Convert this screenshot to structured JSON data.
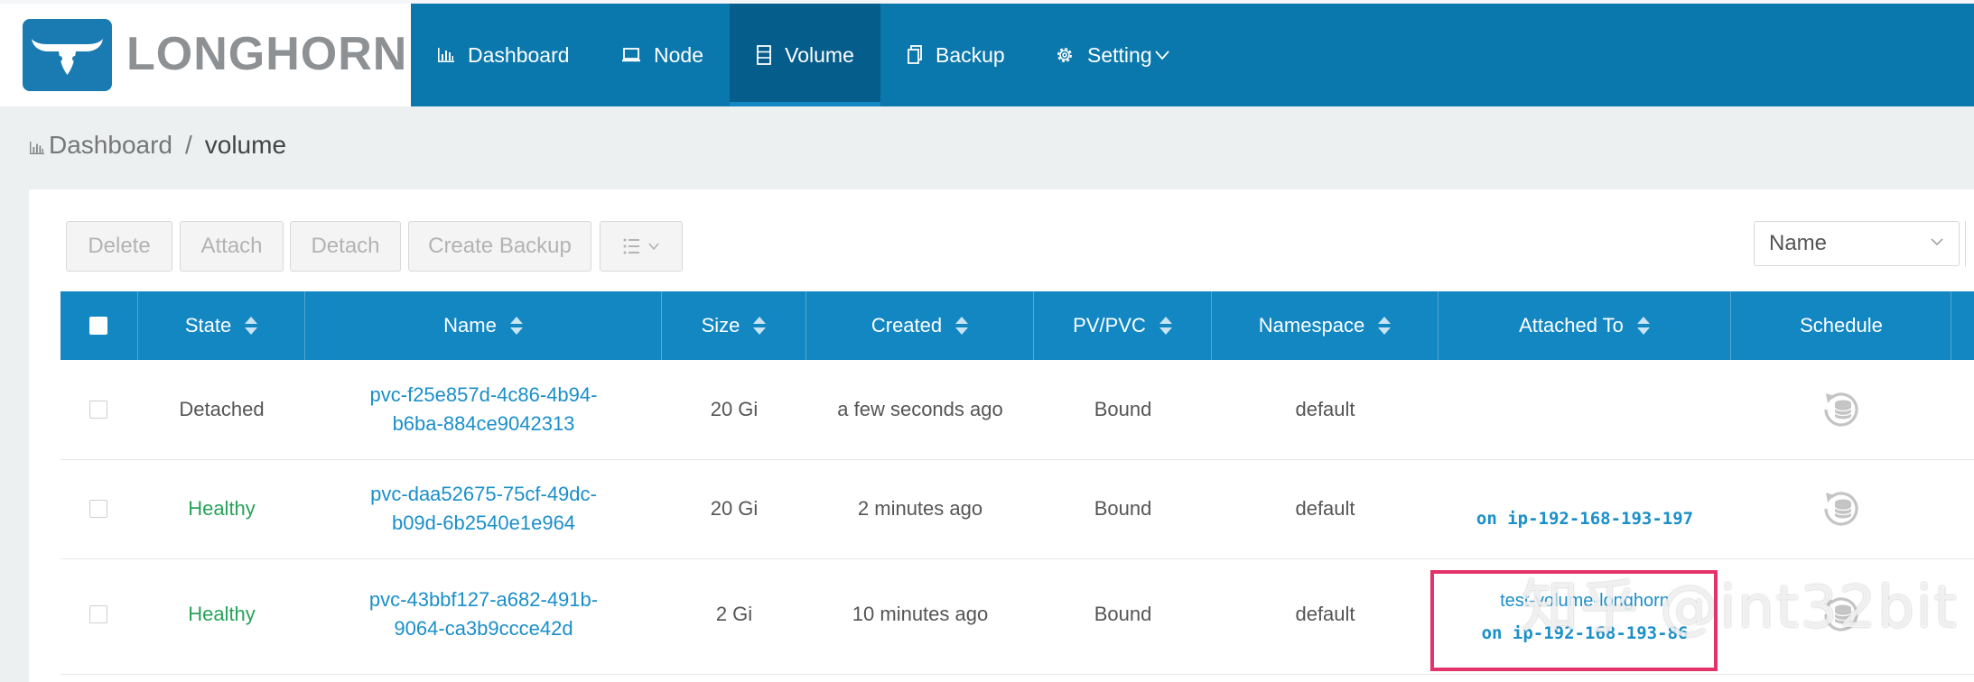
{
  "brand": {
    "name": "LONGHORN"
  },
  "nav": [
    {
      "label": "Dashboard",
      "icon": "bar-chart-icon"
    },
    {
      "label": "Node",
      "icon": "laptop-icon"
    },
    {
      "label": "Volume",
      "icon": "database-icon",
      "active": true
    },
    {
      "label": "Backup",
      "icon": "copy-icon"
    },
    {
      "label": "Setting",
      "icon": "gear-icon"
    }
  ],
  "breadcrumb": {
    "home": "Dashboard",
    "separator": "/",
    "current": "volume"
  },
  "toolbar": {
    "delete": "Delete",
    "attach": "Attach",
    "detach": "Detach",
    "create_backup": "Create Backup",
    "sort_select_value": "Name"
  },
  "table": {
    "columns": [
      "State",
      "Name",
      "Size",
      "Created",
      "PV/PVC",
      "Namespace",
      "Attached To",
      "Schedule"
    ],
    "rows": [
      {
        "state": "Detached",
        "name_line1": "pvc-f25e857d-4c86-4b94-",
        "name_line2": "b6ba-884ce9042313",
        "size": "20 Gi",
        "created": "a few seconds ago",
        "pvpvc": "Bound",
        "namespace": "default",
        "attached_name": "",
        "attached_node": ""
      },
      {
        "state": "Healthy",
        "name_line1": "pvc-daa52675-75cf-49dc-",
        "name_line2": "b09d-6b2540e1e964",
        "size": "20 Gi",
        "created": "2 minutes ago",
        "pvpvc": "Bound",
        "namespace": "default",
        "attached_name": "",
        "attached_node": "on ip-192-168-193-197"
      },
      {
        "state": "Healthy",
        "name_line1": "pvc-43bbf127-a682-491b-",
        "name_line2": "9064-ca3b9ccce42d",
        "size": "2 Gi",
        "created": "10 minutes ago",
        "pvpvc": "Bound",
        "namespace": "default",
        "attached_name": "test-volume-longhorn",
        "attached_node": "on ip-192-168-193-86"
      }
    ]
  },
  "watermark": "知乎 @int32bit",
  "colors": {
    "header_blue": "#0a78ad",
    "active_nav": "#055d8c",
    "table_header": "#1287c2",
    "healthy_green": "#27a35a",
    "link_blue": "#1a8fc9",
    "highlight_pink": "#e2336b"
  }
}
